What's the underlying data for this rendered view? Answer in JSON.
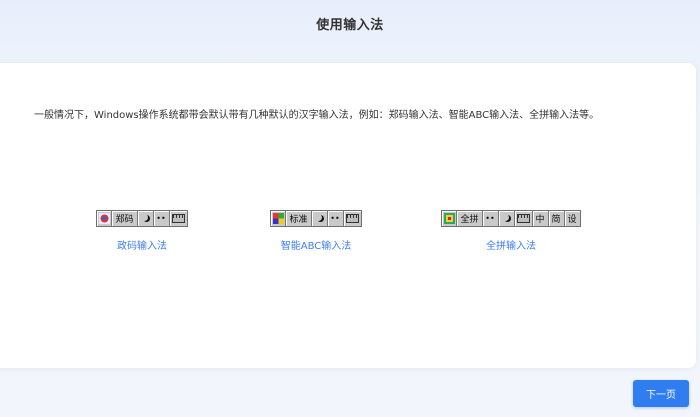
{
  "header": {
    "title": "使用输入法"
  },
  "main": {
    "intro_text": "一般情况下，Windows操作系统都带会默认带有几种默认的汉字输入法，例如：郑码输入法、智能ABC输入法、全拼输入法等。",
    "ime_items": [
      {
        "toolbar_segments": [
          "郑码"
        ],
        "link_label": "政码输入法"
      },
      {
        "toolbar_segments": [
          "标准"
        ],
        "link_label": "智能ABC输入法"
      },
      {
        "toolbar_segments": [
          "全拼",
          "中",
          "简",
          "设"
        ],
        "link_label": "全拼输入法"
      }
    ]
  },
  "footer": {
    "next_label": "下一页"
  },
  "colors": {
    "accent": "#2f7df0",
    "link": "#3d7ef5"
  },
  "icons": [
    "ime-logo-icon",
    "half-moon-icon",
    "punctuation-dots-icon",
    "soft-keyboard-icon"
  ]
}
